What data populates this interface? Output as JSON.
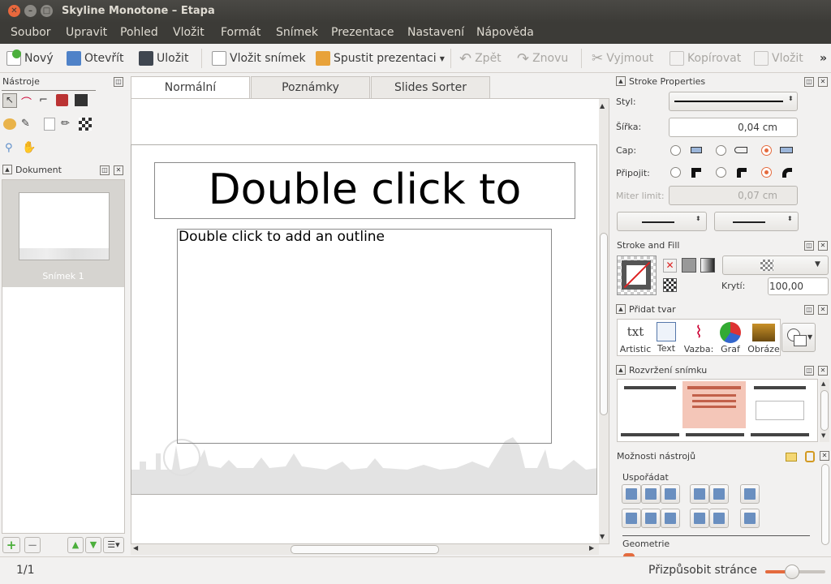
{
  "window": {
    "title": "Skyline Monotone – Etapa"
  },
  "menu": [
    "Soubor",
    "Upravit",
    "Pohled",
    "Vložit",
    "Formát",
    "Snímek",
    "Prezentace",
    "Nastavení",
    "Nápověda"
  ],
  "toolbar": {
    "new": "Nový",
    "open": "Otevřít",
    "save": "Uložit",
    "insert_slide": "Vložit snímek",
    "start_presentation": "Spustit prezentaci",
    "undo": "Zpět",
    "redo": "Znovu",
    "cut": "Vyjmout",
    "copy": "Kopírovat",
    "paste": "Vložit",
    "more": "»"
  },
  "left": {
    "tools_title": "Nástroje",
    "document_title": "Dokument",
    "slide_label": "Snímek 1"
  },
  "tabs": [
    "Normální",
    "Poznámky",
    "Slides Sorter"
  ],
  "slide": {
    "title_placeholder": "Double click to",
    "outline_placeholder": "Double click to add an outline"
  },
  "stroke": {
    "title": "Stroke Properties",
    "style_label": "Styl:",
    "width_label": "Šířka:",
    "width_value": "0,04 cm",
    "cap_label": "Cap:",
    "join_label": "Připojit:",
    "miter_label": "Miter limit:",
    "miter_value": "0,07 cm"
  },
  "fill": {
    "title": "Stroke and Fill",
    "opacity_label": "Krytí:",
    "opacity_value": "100,00"
  },
  "add_shape": {
    "title": "Přidat tvar",
    "items": [
      "Artistic",
      "Text",
      "Vazba:",
      "Graf",
      "Obráze"
    ],
    "artistic_glyph": "txt"
  },
  "layout": {
    "title": "Rozvržení snímku"
  },
  "tool_options": {
    "title": "Možnosti nástrojů",
    "arrange": "Uspořádat",
    "geometry": "Geometrie"
  },
  "status": {
    "page": "1/1",
    "zoom": "Přizpůsobit stránce",
    "zoom_level": 0.44
  },
  "colors": {
    "accent": "#e46b3e",
    "titlebar": "#3c3b37",
    "selection": "#f4c6b8"
  }
}
